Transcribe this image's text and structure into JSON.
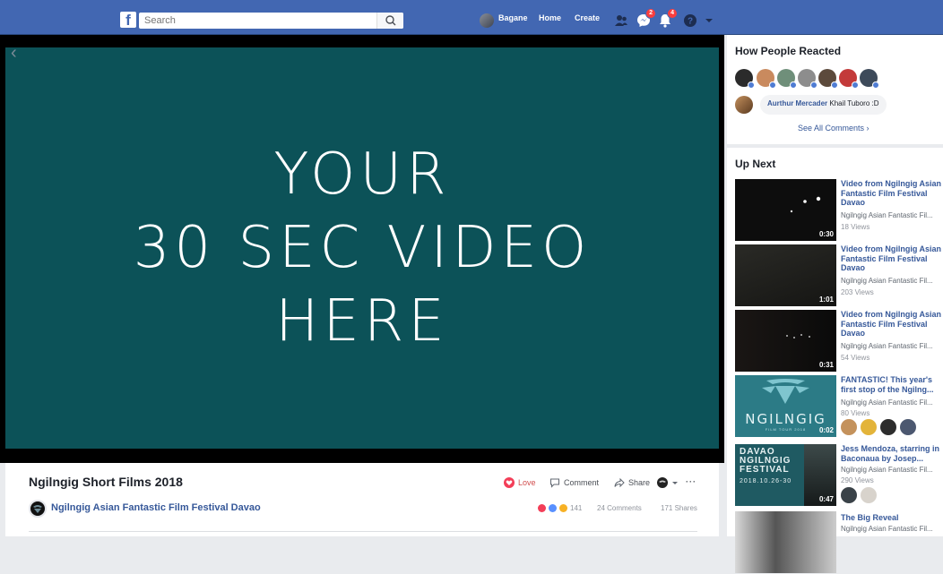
{
  "topbar": {
    "logo": "f",
    "search_placeholder": "Search",
    "user_name": "Bagane",
    "nav_home": "Home",
    "nav_create": "Create",
    "messages_badge": "2",
    "notifications_badge": "4"
  },
  "video": {
    "overlay_line1": "YOUR",
    "overlay_line2": "30 SEC VIDEO",
    "overlay_line3": "HERE",
    "background_color": "#0c5258"
  },
  "info": {
    "title": "Ngilngig Short Films 2018",
    "page_name": "Ngilngig Asian Fantastic Film Festival Davao",
    "love_label": "Love",
    "comment_label": "Comment",
    "share_label": "Share",
    "reaction_count": "141",
    "comments_count": "24 Comments",
    "shares_count": "171 Shares"
  },
  "reactions": {
    "title": "How People Reacted",
    "comment_author": "Aurthur Mercader",
    "comment_text": "Khail Tuboro :D",
    "see_all": "See All Comments"
  },
  "up_next": {
    "title": "Up Next",
    "items": [
      {
        "title": "Video from Ngilngig Asian Fantastic Film Festival Davao",
        "channel": "Ngilngig Asian Fantastic Fil...",
        "views": "18 Views",
        "duration": "0:30"
      },
      {
        "title": "Video from Ngilngig Asian Fantastic Film Festival Davao",
        "channel": "Ngilngig Asian Fantastic Fil...",
        "views": "203 Views",
        "duration": "1:01"
      },
      {
        "title": "Video from Ngilngig Asian Fantastic Film Festival Davao",
        "channel": "Ngilngig Asian Fantastic Fil...",
        "views": "54 Views",
        "duration": "0:31"
      },
      {
        "title": "FANTASTIC! This year's first stop of the Ngilng...",
        "channel": "Ngilngig Asian Fantastic Fil...",
        "views": "80 Views",
        "duration": "0:02",
        "thumb_text": "NGILNGIG",
        "thumb_sub": "FILM TOUR 2018"
      },
      {
        "title": "Jess Mendoza, starring in Baconaua by Josep...",
        "channel": "Ngilngig Asian Fantastic Fil...",
        "views": "290 Views",
        "duration": "0:47",
        "thumb_text": "DAVAO NGILNGIG FESTIVAL",
        "thumb_date": "2018.10.26-30"
      },
      {
        "title": "The Big Reveal",
        "channel": "Ngilngig Asian Fantastic Fil...",
        "views": "",
        "duration": ""
      }
    ]
  }
}
